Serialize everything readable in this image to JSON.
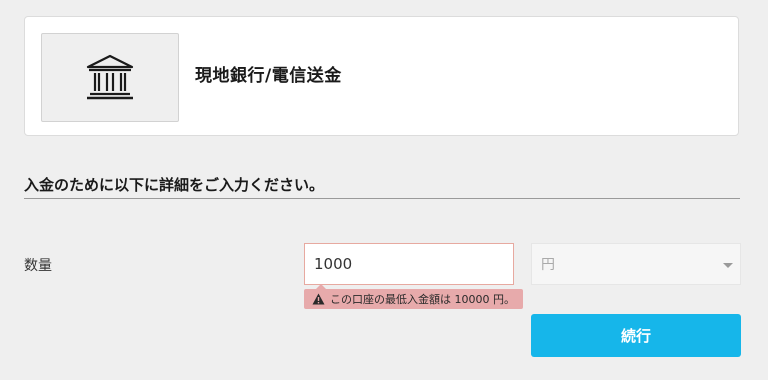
{
  "payment_method": {
    "title": "現地銀行/電信送金",
    "icon": "bank-icon"
  },
  "form": {
    "heading": "入金のために以下に詳細をご入力ください。",
    "amount": {
      "label": "数量",
      "value": "1000"
    },
    "currency": {
      "selected": "円"
    },
    "error": {
      "icon": "warning-icon",
      "message": "この口座の最低入金額は 10000 円。"
    },
    "continue_label": "続行"
  },
  "colors": {
    "primary_button": "#16b6ea",
    "error_background": "#e7aaab",
    "error_border": "#e7a9a0",
    "page_background": "#efefef"
  }
}
